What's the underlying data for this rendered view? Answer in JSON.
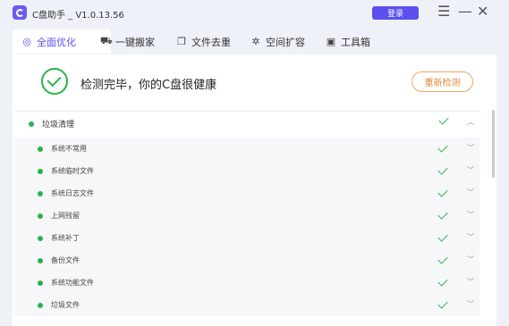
{
  "app": {
    "title": "C盘助手 _ V1.0.13.56",
    "login_label": "登录"
  },
  "window_controls": {
    "menu": "☰",
    "minimize": "—",
    "close": "✕"
  },
  "tabs": [
    {
      "label": "全面优化",
      "icon": "shield-icon",
      "glyph": "◎",
      "active": true
    },
    {
      "label": "一键搬家",
      "icon": "truck-icon",
      "glyph": "⛟",
      "active": false
    },
    {
      "label": "文件去重",
      "icon": "file-copy-icon",
      "glyph": "❐",
      "active": false
    },
    {
      "label": "空间扩容",
      "icon": "rocket-icon",
      "glyph": "✲",
      "active": false
    },
    {
      "label": "工具箱",
      "icon": "toolbox-icon",
      "glyph": "▣",
      "active": false
    }
  ],
  "status": {
    "text": "检测完毕，你的C盘很健康",
    "recheck_label": "重新检测"
  },
  "category": {
    "label": "垃圾清理",
    "status_color": "#29b34a"
  },
  "items": [
    {
      "label": "系统不常用"
    },
    {
      "label": "系统临时文件"
    },
    {
      "label": "系统日志文件"
    },
    {
      "label": "上网残留"
    },
    {
      "label": "系统补丁"
    },
    {
      "label": "备份文件"
    },
    {
      "label": "系统功能文件"
    },
    {
      "label": "垃圾文件"
    }
  ],
  "colors": {
    "accent": "#5b4ff0",
    "ok": "#29b34a",
    "warn": "#e8873a"
  }
}
